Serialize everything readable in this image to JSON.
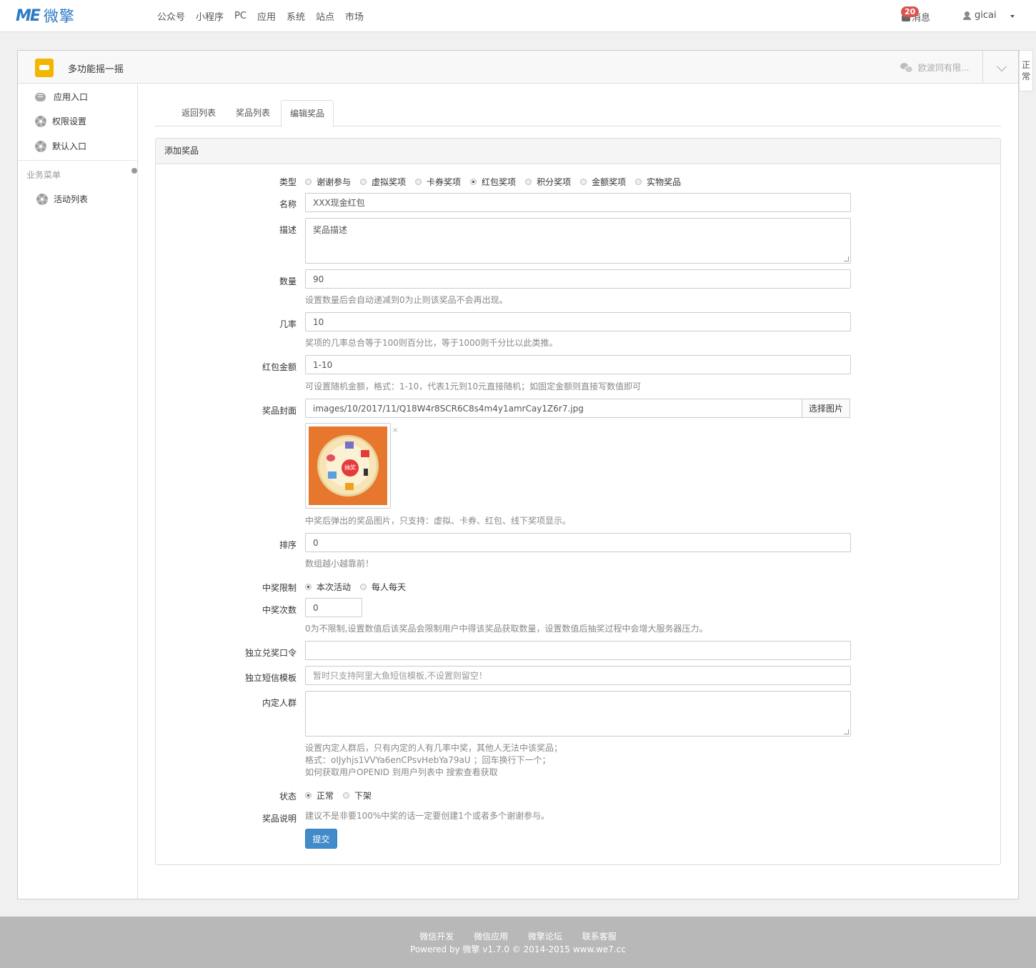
{
  "brand": {
    "mark": "ME",
    "name": "微擎"
  },
  "topnav": [
    "公众号",
    "小程序",
    "PC",
    "应用",
    "系统",
    "站点",
    "市场"
  ],
  "header": {
    "messages_label": "消息",
    "messages_badge": "20",
    "username": "gicai"
  },
  "app": {
    "title": "多功能摇一摇",
    "account": "欧波同有限...",
    "side_tab": "正常"
  },
  "sidebar": {
    "items": [
      "应用入口",
      "权限设置",
      "默认入口"
    ],
    "group_label": "业务菜单",
    "group_items": [
      "活动列表"
    ]
  },
  "tabs": [
    "返回列表",
    "奖品列表",
    "编辑奖品"
  ],
  "form": {
    "title": "添加奖品",
    "type": {
      "label": "类型",
      "options": [
        "谢谢参与",
        "虚拟奖项",
        "卡券奖项",
        "红包奖项",
        "积分奖项",
        "金额奖项",
        "实物奖品"
      ],
      "selected": "红包奖项"
    },
    "name": {
      "label": "名称",
      "value": "XXX现金红包"
    },
    "desc": {
      "label": "描述",
      "value": "奖品描述"
    },
    "quantity": {
      "label": "数量",
      "value": "90",
      "help": "设置数量后会自动递减到0为止则该奖品不会再出现。"
    },
    "probability": {
      "label": "几率",
      "value": "10",
      "help": "奖项的几率总合等于100则百分比，等于1000则千分比以此类推。"
    },
    "amount": {
      "label": "红包金额",
      "value": "1-10",
      "help": "可设置随机金额，格式：1-10，代表1元到10元直接随机；如固定金额则直接写数值即可"
    },
    "cover": {
      "label": "奖品封面",
      "value": "images/10/2017/11/Q18W4r8SCR6C8s4m4y1amrCay1Z6r7.jpg",
      "button": "选择图片",
      "remove": "×",
      "image_hub_text": "抽奖",
      "help": "中奖后弹出的奖品图片，只支持：虚拟、卡券、红包、线下奖项显示。"
    },
    "sort": {
      "label": "排序",
      "value": "0",
      "help": "数组越小越靠前！"
    },
    "win_limit": {
      "label": "中奖限制",
      "options": [
        "本次活动",
        "每人每天"
      ],
      "selected": "本次活动"
    },
    "win_count": {
      "label": "中奖次数",
      "value": "0",
      "help": "0为不限制,设置数值后该奖品会限制用户中得该奖品获取数量，设置数值后抽奖过程中会增大服务器压力。"
    },
    "redeem_code": {
      "label": "独立兑奖口令",
      "value": ""
    },
    "sms_template": {
      "label": "独立短信模板",
      "placeholder": "暂时只支持阿里大鱼短信模板,不设置则留空！"
    },
    "internal_group": {
      "label": "内定人群",
      "value": "",
      "help_lines": [
        "设置内定人群后，只有内定的人有几率中奖，其他人无法中该奖品；",
        "格式：oIJyhjs1VVYa6enCPsvHebYa79aU ；回车换行下一个；",
        "如何获取用户OPENID 到用户列表中 搜索查看获取"
      ]
    },
    "status": {
      "label": "状态",
      "options": [
        "正常",
        "下架"
      ],
      "selected": "正常"
    },
    "note": {
      "label": "奖品说明",
      "text": "建议不是非要100%中奖的话一定要创建1个或者多个谢谢参与。"
    },
    "submit": "提交"
  },
  "footer": {
    "links": [
      "微信开发",
      "微信应用",
      "微擎论坛",
      "联系客服"
    ],
    "copyright": "Powered by 微擎 v1.7.0 © 2014-2015 www.we7.cc"
  },
  "colors": {
    "primary": "#428bca",
    "badge": "#d9534f",
    "brand": "#2d7bc4",
    "app_icon": "#f3b600",
    "footer_bg": "#b8b8b8"
  }
}
